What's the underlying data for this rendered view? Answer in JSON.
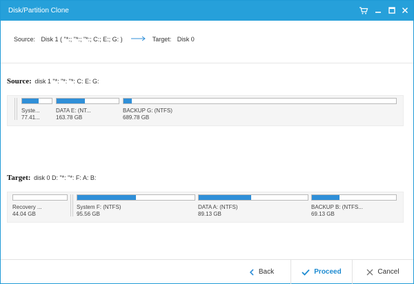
{
  "window": {
    "title": "Disk/Partition Clone"
  },
  "titlebar_icons": [
    "cart-icon",
    "minimize-icon",
    "maximize-icon",
    "close-icon"
  ],
  "route": {
    "source_label": "Source:",
    "source_value": "Disk 1 ( \"*:; \"*:; \"*:; C:; E:; G: )",
    "target_label": "Target:",
    "target_value": "Disk 0"
  },
  "source": {
    "heading": "Source:",
    "description": "disk 1 \"*: \"*: \"*: C: E: G:",
    "partitions": [
      {
        "name": "Syste...",
        "size": "77.41...",
        "used_fraction": 0.55
      },
      {
        "name": "DATA E: (NT...",
        "size": "163.78 GB",
        "used_fraction": 0.45
      },
      {
        "name": "BACKUP G: (NTFS)",
        "size": "689.78 GB",
        "used_fraction": 0.03
      }
    ]
  },
  "target": {
    "heading": "Target:",
    "description": "disk 0 D: \"*: \"*: F: A: B:",
    "partitions": [
      {
        "name": "Recovery ...",
        "size": "44.04 GB",
        "used_fraction": 0.0
      },
      {
        "name": "System F: (NTFS)",
        "size": "95.56 GB",
        "used_fraction": 0.5
      },
      {
        "name": "DATA A: (NTFS)",
        "size": "89.13 GB",
        "used_fraction": 0.48
      },
      {
        "name": "BACKUP B: (NTFS...",
        "size": "69.13 GB",
        "used_fraction": 0.33
      }
    ]
  },
  "footer": {
    "back_label": "Back",
    "proceed_label": "Proceed",
    "cancel_label": "Cancel"
  },
  "colors": {
    "titlebar": "#26a0da",
    "usage_fill": "#2f8fd8",
    "proceed_text": "#1d8bd1"
  }
}
